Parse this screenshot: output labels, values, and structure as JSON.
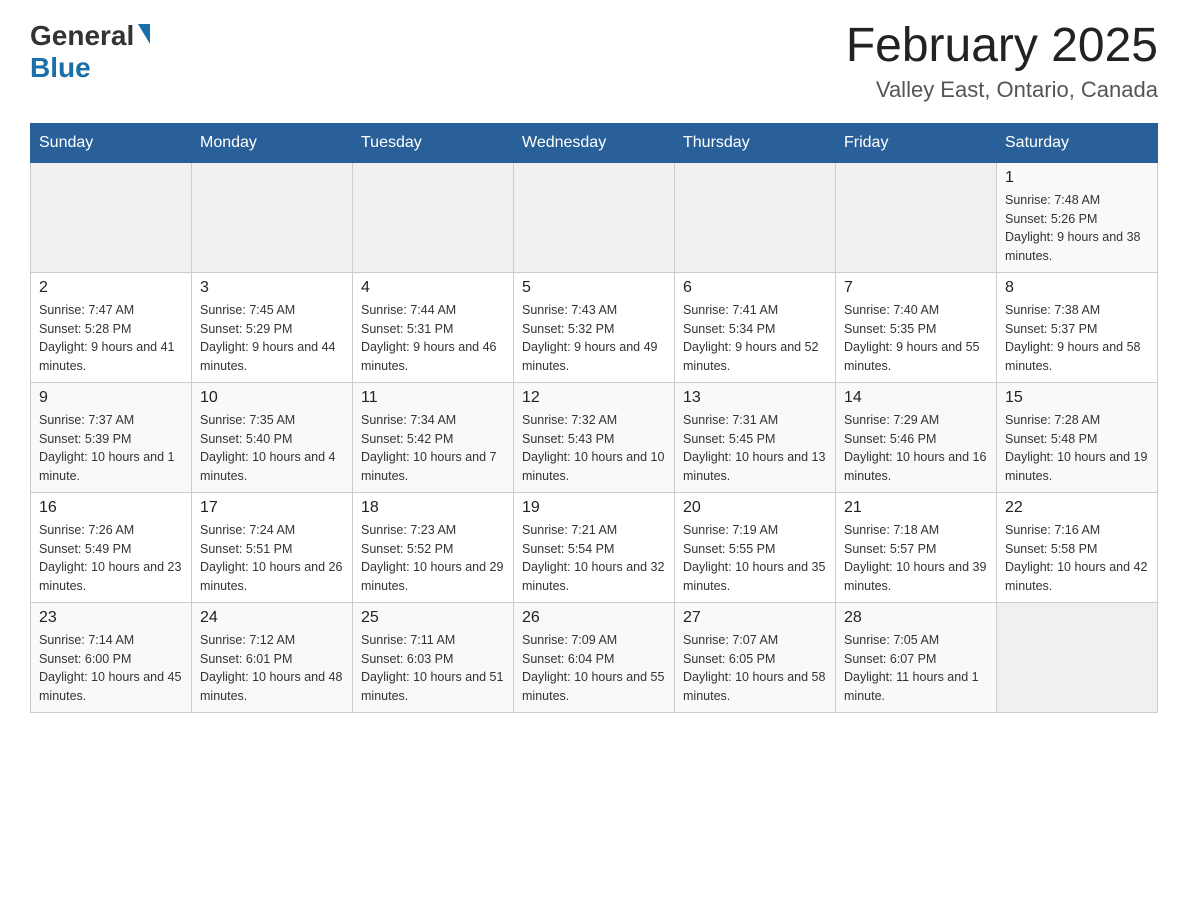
{
  "header": {
    "logo_general": "General",
    "logo_blue": "Blue",
    "month_title": "February 2025",
    "location": "Valley East, Ontario, Canada"
  },
  "days_of_week": [
    "Sunday",
    "Monday",
    "Tuesday",
    "Wednesday",
    "Thursday",
    "Friday",
    "Saturday"
  ],
  "weeks": [
    [
      {
        "day": "",
        "sunrise": "",
        "sunset": "",
        "daylight": ""
      },
      {
        "day": "",
        "sunrise": "",
        "sunset": "",
        "daylight": ""
      },
      {
        "day": "",
        "sunrise": "",
        "sunset": "",
        "daylight": ""
      },
      {
        "day": "",
        "sunrise": "",
        "sunset": "",
        "daylight": ""
      },
      {
        "day": "",
        "sunrise": "",
        "sunset": "",
        "daylight": ""
      },
      {
        "day": "",
        "sunrise": "",
        "sunset": "",
        "daylight": ""
      },
      {
        "day": "1",
        "sunrise": "Sunrise: 7:48 AM",
        "sunset": "Sunset: 5:26 PM",
        "daylight": "Daylight: 9 hours and 38 minutes."
      }
    ],
    [
      {
        "day": "2",
        "sunrise": "Sunrise: 7:47 AM",
        "sunset": "Sunset: 5:28 PM",
        "daylight": "Daylight: 9 hours and 41 minutes."
      },
      {
        "day": "3",
        "sunrise": "Sunrise: 7:45 AM",
        "sunset": "Sunset: 5:29 PM",
        "daylight": "Daylight: 9 hours and 44 minutes."
      },
      {
        "day": "4",
        "sunrise": "Sunrise: 7:44 AM",
        "sunset": "Sunset: 5:31 PM",
        "daylight": "Daylight: 9 hours and 46 minutes."
      },
      {
        "day": "5",
        "sunrise": "Sunrise: 7:43 AM",
        "sunset": "Sunset: 5:32 PM",
        "daylight": "Daylight: 9 hours and 49 minutes."
      },
      {
        "day": "6",
        "sunrise": "Sunrise: 7:41 AM",
        "sunset": "Sunset: 5:34 PM",
        "daylight": "Daylight: 9 hours and 52 minutes."
      },
      {
        "day": "7",
        "sunrise": "Sunrise: 7:40 AM",
        "sunset": "Sunset: 5:35 PM",
        "daylight": "Daylight: 9 hours and 55 minutes."
      },
      {
        "day": "8",
        "sunrise": "Sunrise: 7:38 AM",
        "sunset": "Sunset: 5:37 PM",
        "daylight": "Daylight: 9 hours and 58 minutes."
      }
    ],
    [
      {
        "day": "9",
        "sunrise": "Sunrise: 7:37 AM",
        "sunset": "Sunset: 5:39 PM",
        "daylight": "Daylight: 10 hours and 1 minute."
      },
      {
        "day": "10",
        "sunrise": "Sunrise: 7:35 AM",
        "sunset": "Sunset: 5:40 PM",
        "daylight": "Daylight: 10 hours and 4 minutes."
      },
      {
        "day": "11",
        "sunrise": "Sunrise: 7:34 AM",
        "sunset": "Sunset: 5:42 PM",
        "daylight": "Daylight: 10 hours and 7 minutes."
      },
      {
        "day": "12",
        "sunrise": "Sunrise: 7:32 AM",
        "sunset": "Sunset: 5:43 PM",
        "daylight": "Daylight: 10 hours and 10 minutes."
      },
      {
        "day": "13",
        "sunrise": "Sunrise: 7:31 AM",
        "sunset": "Sunset: 5:45 PM",
        "daylight": "Daylight: 10 hours and 13 minutes."
      },
      {
        "day": "14",
        "sunrise": "Sunrise: 7:29 AM",
        "sunset": "Sunset: 5:46 PM",
        "daylight": "Daylight: 10 hours and 16 minutes."
      },
      {
        "day": "15",
        "sunrise": "Sunrise: 7:28 AM",
        "sunset": "Sunset: 5:48 PM",
        "daylight": "Daylight: 10 hours and 19 minutes."
      }
    ],
    [
      {
        "day": "16",
        "sunrise": "Sunrise: 7:26 AM",
        "sunset": "Sunset: 5:49 PM",
        "daylight": "Daylight: 10 hours and 23 minutes."
      },
      {
        "day": "17",
        "sunrise": "Sunrise: 7:24 AM",
        "sunset": "Sunset: 5:51 PM",
        "daylight": "Daylight: 10 hours and 26 minutes."
      },
      {
        "day": "18",
        "sunrise": "Sunrise: 7:23 AM",
        "sunset": "Sunset: 5:52 PM",
        "daylight": "Daylight: 10 hours and 29 minutes."
      },
      {
        "day": "19",
        "sunrise": "Sunrise: 7:21 AM",
        "sunset": "Sunset: 5:54 PM",
        "daylight": "Daylight: 10 hours and 32 minutes."
      },
      {
        "day": "20",
        "sunrise": "Sunrise: 7:19 AM",
        "sunset": "Sunset: 5:55 PM",
        "daylight": "Daylight: 10 hours and 35 minutes."
      },
      {
        "day": "21",
        "sunrise": "Sunrise: 7:18 AM",
        "sunset": "Sunset: 5:57 PM",
        "daylight": "Daylight: 10 hours and 39 minutes."
      },
      {
        "day": "22",
        "sunrise": "Sunrise: 7:16 AM",
        "sunset": "Sunset: 5:58 PM",
        "daylight": "Daylight: 10 hours and 42 minutes."
      }
    ],
    [
      {
        "day": "23",
        "sunrise": "Sunrise: 7:14 AM",
        "sunset": "Sunset: 6:00 PM",
        "daylight": "Daylight: 10 hours and 45 minutes."
      },
      {
        "day": "24",
        "sunrise": "Sunrise: 7:12 AM",
        "sunset": "Sunset: 6:01 PM",
        "daylight": "Daylight: 10 hours and 48 minutes."
      },
      {
        "day": "25",
        "sunrise": "Sunrise: 7:11 AM",
        "sunset": "Sunset: 6:03 PM",
        "daylight": "Daylight: 10 hours and 51 minutes."
      },
      {
        "day": "26",
        "sunrise": "Sunrise: 7:09 AM",
        "sunset": "Sunset: 6:04 PM",
        "daylight": "Daylight: 10 hours and 55 minutes."
      },
      {
        "day": "27",
        "sunrise": "Sunrise: 7:07 AM",
        "sunset": "Sunset: 6:05 PM",
        "daylight": "Daylight: 10 hours and 58 minutes."
      },
      {
        "day": "28",
        "sunrise": "Sunrise: 7:05 AM",
        "sunset": "Sunset: 6:07 PM",
        "daylight": "Daylight: 11 hours and 1 minute."
      },
      {
        "day": "",
        "sunrise": "",
        "sunset": "",
        "daylight": ""
      }
    ]
  ]
}
